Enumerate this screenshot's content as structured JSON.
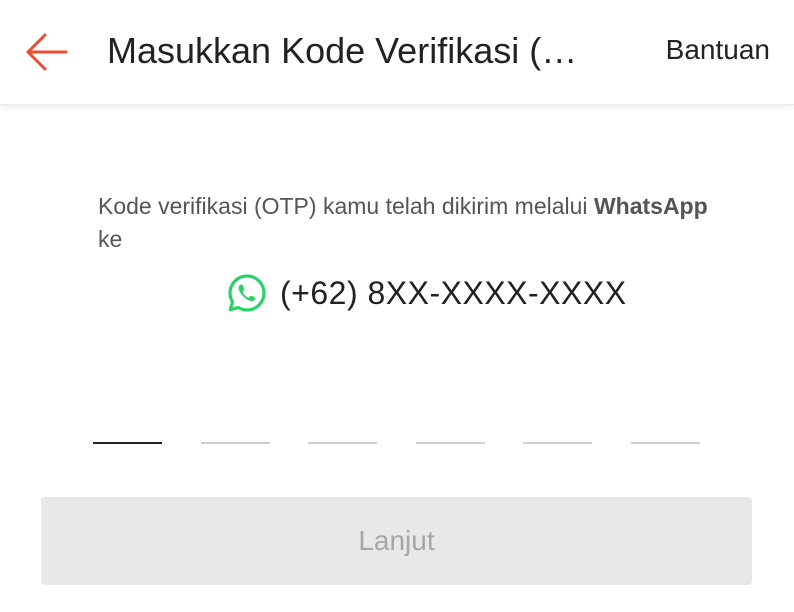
{
  "header": {
    "title": "Masukkan Kode Verifikasi (…",
    "help_label": "Bantuan",
    "back_icon": "arrow-left-icon"
  },
  "info": {
    "message_prefix": "Kode verifikasi (OTP) kamu telah dikirim melalui ",
    "channel": "WhatsApp",
    "message_suffix": " ke"
  },
  "recipient": {
    "icon": "whatsapp-icon",
    "phone": "(+62) 8XX-XXXX-XXXX"
  },
  "otp": {
    "cells": [
      "",
      "",
      "",
      "",
      "",
      ""
    ]
  },
  "actions": {
    "next_label": "Lanjut"
  },
  "colors": {
    "accent": "#ee4d2d",
    "whatsapp": "#25d366",
    "disabled_bg": "#e8e8e8",
    "disabled_text": "#a6a6a6"
  }
}
